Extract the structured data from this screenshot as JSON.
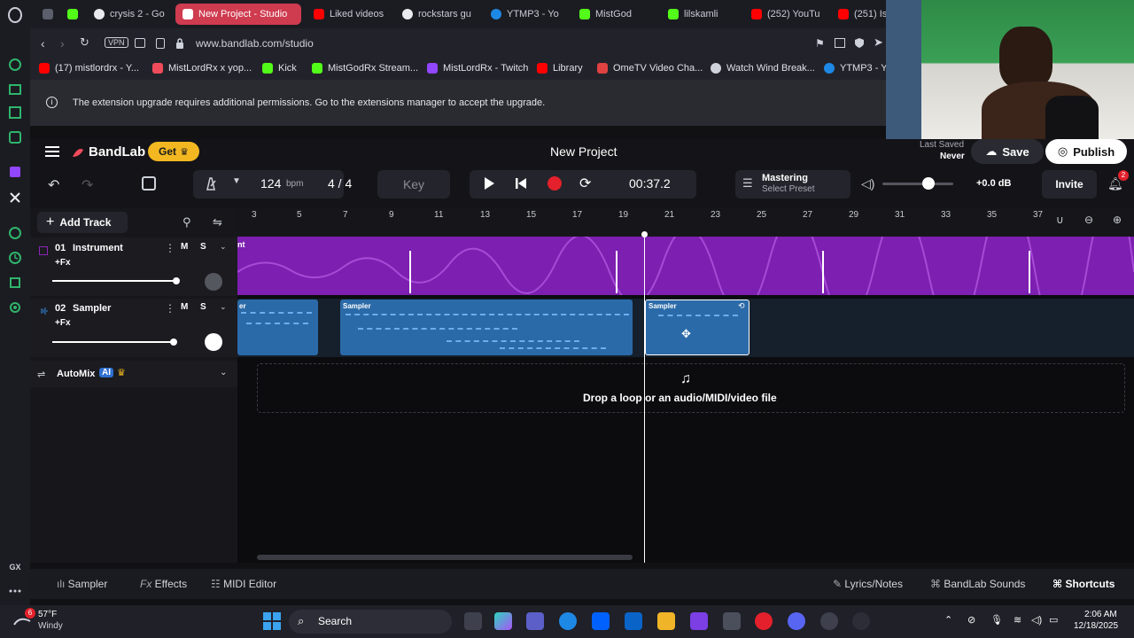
{
  "tabs": [
    {
      "label": "",
      "fav_color": "#5b5f6b"
    },
    {
      "label": "",
      "fav_color": "#53fc18"
    },
    {
      "label": "crysis 2 - Go",
      "fav_color": "#e9eaee"
    },
    {
      "label": "New Project - Studio",
      "fav_color": "#f04b5b"
    },
    {
      "label": "Liked videos",
      "fav_color": "#ff0000"
    },
    {
      "label": "rockstars gu",
      "fav_color": "#e9eaee"
    },
    {
      "label": "YTMP3 - Yo",
      "fav_color": "#1e88e5"
    },
    {
      "label": "MistGod",
      "fav_color": "#53fc18"
    },
    {
      "label": "lilskamli",
      "fav_color": "#53fc18"
    },
    {
      "label": "(252) YouTu",
      "fav_color": "#ff0000"
    },
    {
      "label": "(251) Is",
      "fav_color": "#ff0000"
    }
  ],
  "address": {
    "url": "www.bandlab.com/studio",
    "vpn_label": "VPN"
  },
  "bookmarks": [
    {
      "label": "(17) mistlordrx - Y...",
      "color": "#ff0000"
    },
    {
      "label": "MistLordRx x yop...",
      "color": "#f04b5b"
    },
    {
      "label": "Kick",
      "color": "#53fc18"
    },
    {
      "label": "MistGodRx Stream...",
      "color": "#53fc18"
    },
    {
      "label": "MistLordRx - Twitch",
      "color": "#9146ff"
    },
    {
      "label": "Library",
      "color": "#ff0000"
    },
    {
      "label": "OmeTV Video Cha...",
      "color": "#e04141"
    },
    {
      "label": "Watch Wind Break...",
      "color": "#cfd2da"
    },
    {
      "label": "YTMP3 - Yo",
      "color": "#1e88e5"
    }
  ],
  "notice": {
    "text": "The extension upgrade requires additional permissions. Go to the extensions manager to accept the upgrade."
  },
  "header": {
    "brand": "BandLab",
    "get_label": "Get",
    "project_title": "New Project",
    "last_saved_label": "Last Saved",
    "last_saved_value": "Never",
    "save_label": "Save",
    "publish_label": "Publish"
  },
  "transport": {
    "bpm_value": "124",
    "bpm_unit": "bpm",
    "time_signature": "4 / 4",
    "key_label": "Key",
    "time_display": "00:37.2",
    "mastering_label": "Mastering",
    "mastering_preset": "Select Preset",
    "gain": "+0.0 dB",
    "invite_label": "Invite",
    "notif_count": "2"
  },
  "add_track_label": "Add Track",
  "ruler_ticks": [
    "3",
    "5",
    "7",
    "9",
    "11",
    "13",
    "15",
    "17",
    "19",
    "21",
    "23",
    "25",
    "27",
    "29",
    "31",
    "33",
    "35",
    "37"
  ],
  "tracks": [
    {
      "number": "01",
      "name": "Instrument",
      "fx_label": "+Fx",
      "m": "M",
      "s": "S",
      "color": "#8a25b8"
    },
    {
      "number": "02",
      "name": "Sampler",
      "fx_label": "+Fx",
      "m": "M",
      "s": "S",
      "color": "#2e6fb0"
    }
  ],
  "clips": [
    {
      "label": "er"
    },
    {
      "label": "Sampler"
    },
    {
      "label": "Sampler"
    }
  ],
  "instrument_clip_label": "nt",
  "automix": {
    "label": "AutoMix",
    "ai_label": "AI"
  },
  "drop_zone": {
    "text": "Drop a loop or an audio/MIDI/video file"
  },
  "bottom": {
    "sampler": "Sampler",
    "effects": "Effects",
    "midi_editor": "MIDI Editor",
    "lyrics": "Lyrics/Notes",
    "sounds": "BandLab Sounds",
    "shortcuts": "Shortcuts"
  },
  "sidebar_gx": "GX",
  "taskbar": {
    "weather_temp": "57°F",
    "weather_desc": "Windy",
    "search_label": "Search",
    "time": "2:06 AM",
    "date": "12/18/2025",
    "weather_badge": "6"
  },
  "colors": {
    "accent": "#f04b5b",
    "instrument": "#8a25b8",
    "sampler": "#2e6fb0",
    "record": "#e3202b"
  }
}
